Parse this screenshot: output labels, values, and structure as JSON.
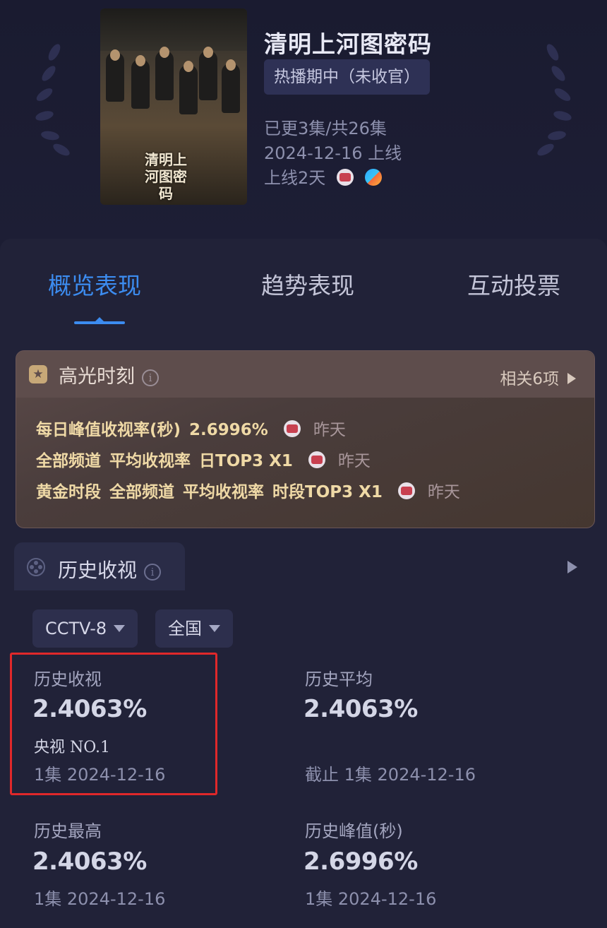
{
  "show": {
    "title": "清明上河图密码",
    "status": "热播期中（未收官）",
    "episodes": "已更3集/共26集",
    "premiere": "2024-12-16 上线",
    "days_online": "上线2天",
    "platform_icons": [
      "cctv-icon",
      "youku-icon"
    ],
    "poster_title": "清明上河图密码"
  },
  "tabs": [
    {
      "label": "概览表现",
      "active": true
    },
    {
      "label": "趋势表现",
      "active": false
    },
    {
      "label": "互动投票",
      "active": false
    }
  ],
  "highlight": {
    "title": "高光时刻",
    "more": "相关6项",
    "items": [
      {
        "parts": [
          "每日峰值收视率(秒)",
          "2.6996%"
        ],
        "when": "昨天"
      },
      {
        "parts": [
          "全部频道",
          "平均收视率",
          "日TOP3 X1"
        ],
        "when": "昨天"
      },
      {
        "parts": [
          "黄金时段",
          "全部频道",
          "平均收视率",
          "时段TOP3 X1"
        ],
        "when": "昨天"
      }
    ]
  },
  "history": {
    "title": "历史收视",
    "filters": [
      "CCTV-8",
      "全国"
    ],
    "stats": [
      {
        "label": "历史收视",
        "value": "2.4063%",
        "rank": "央视 NO.1",
        "note": "1集 2024-12-16"
      },
      {
        "label": "历史平均",
        "value": "2.4063%",
        "note": "截止 1集 2024-12-16"
      },
      {
        "label": "历史最高",
        "value": "2.4063%",
        "note": "1集 2024-12-16"
      },
      {
        "label": "历史峰值(秒)",
        "value": "2.6996%",
        "note": "1集 2024-12-16"
      }
    ]
  },
  "colors": {
    "background": "#1c1d33",
    "accent": "#3c8cf0",
    "highlight_text": "#efd9a6",
    "annotation_box": "#e0282a"
  }
}
